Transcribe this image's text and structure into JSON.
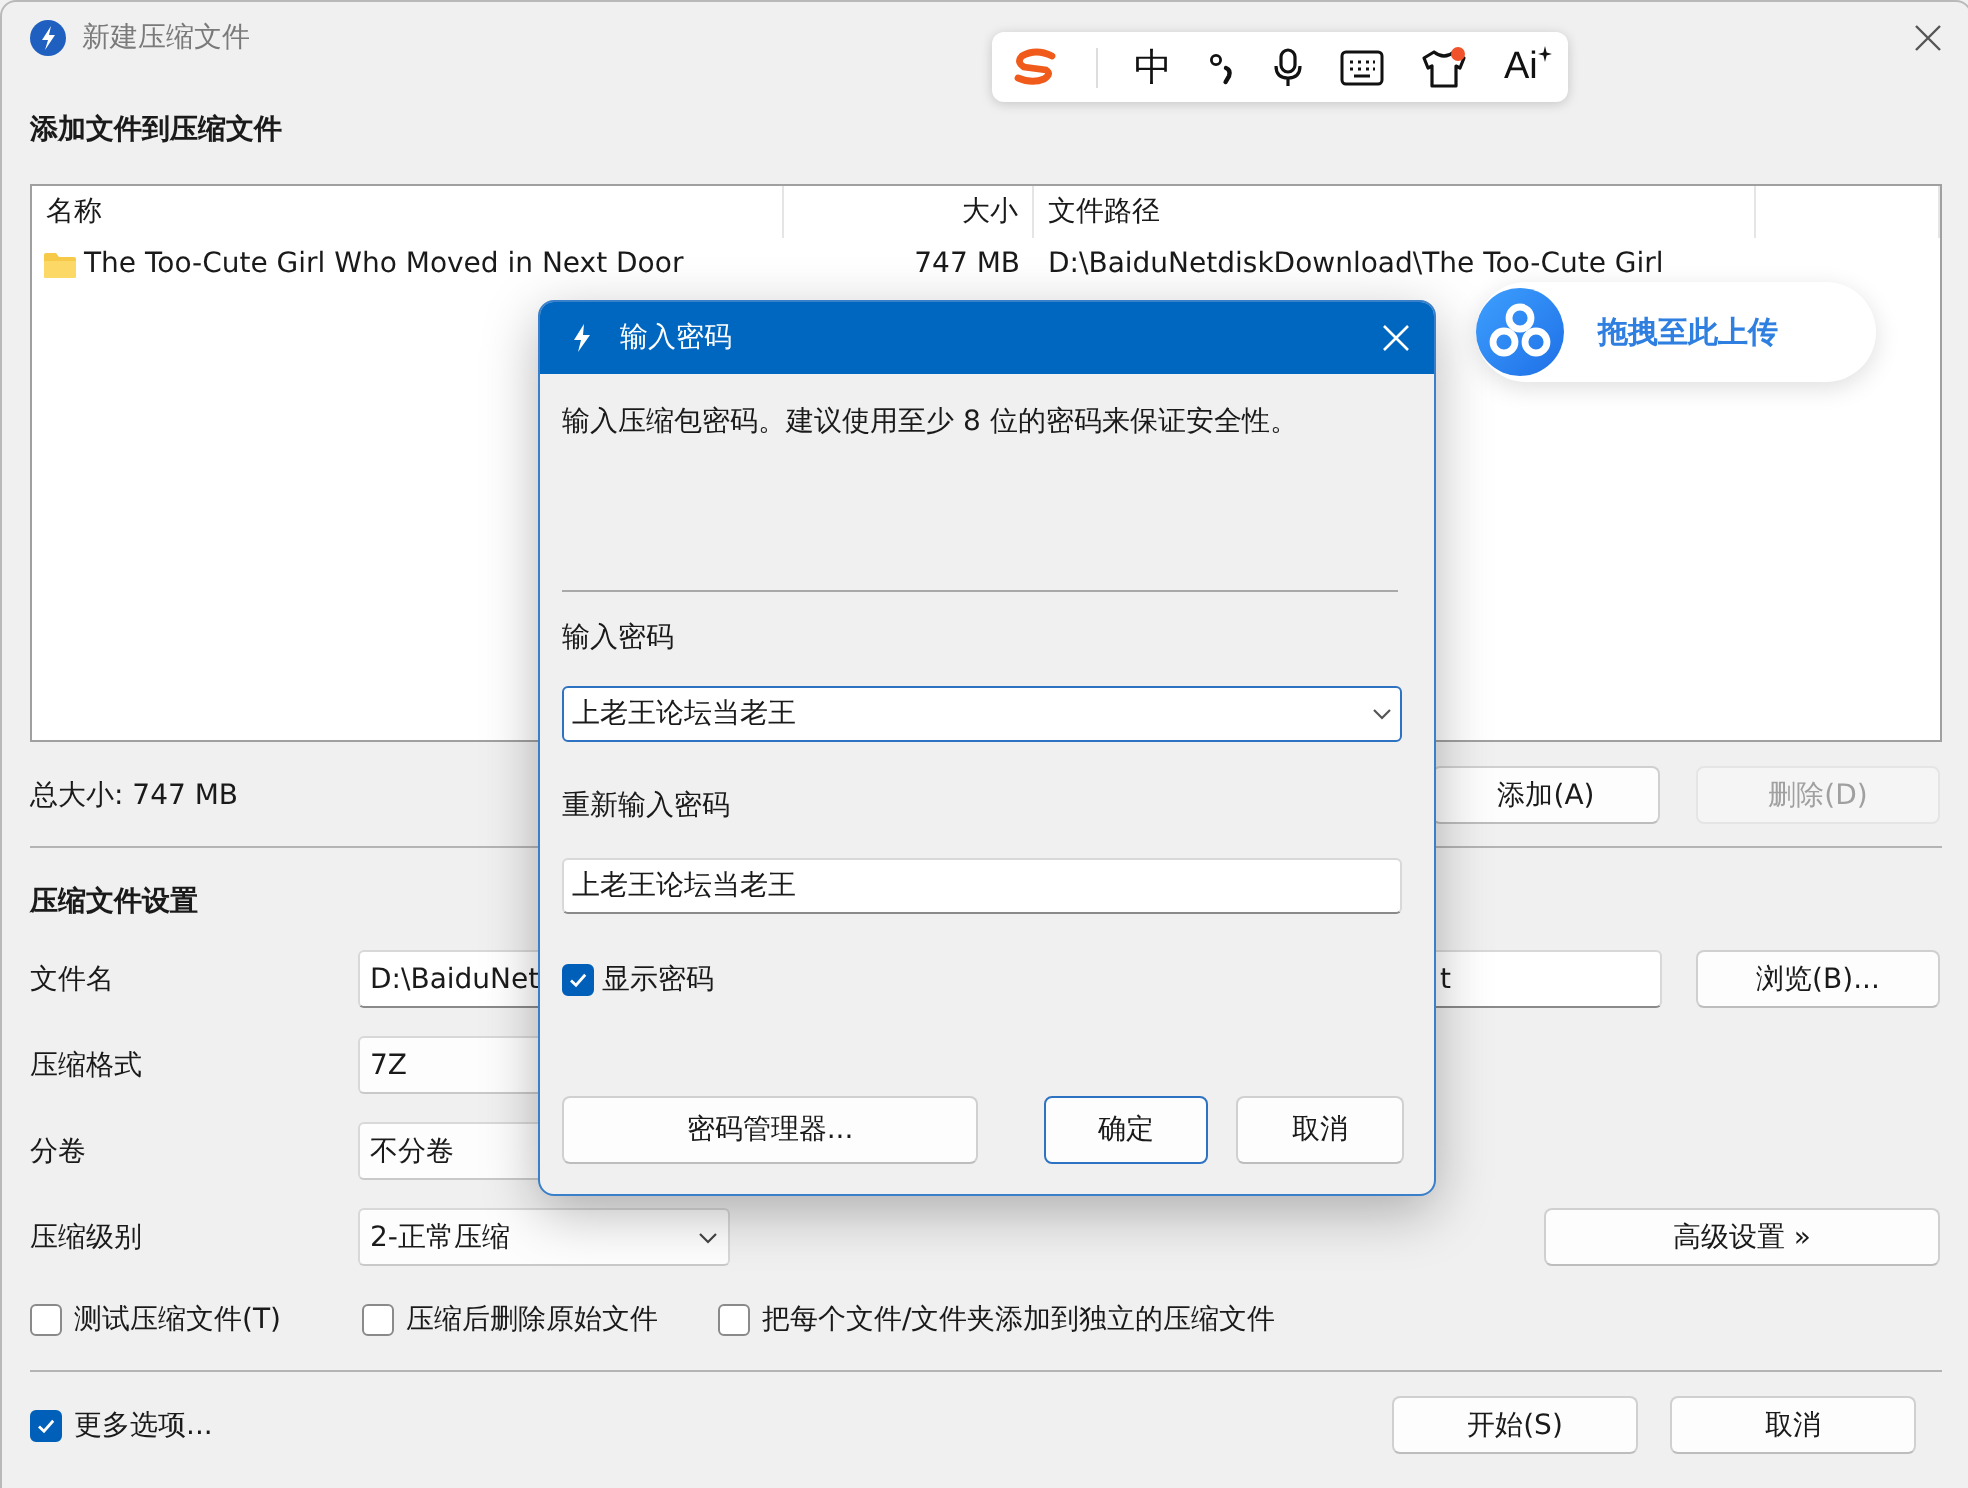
{
  "window": {
    "title": "新建压缩文件"
  },
  "files_section": {
    "heading": "添加文件到压缩文件",
    "columns": [
      "名称",
      "大小",
      "文件路径"
    ],
    "rows": [
      {
        "name": "The Too-Cute Girl Who Moved in Next Door",
        "size": "747 MB",
        "path": "D:\\BaiduNetdiskDownload\\The Too-Cute Girl"
      }
    ],
    "total": "总大小: 747 MB",
    "buttons": [
      {
        "label": "添加(A)",
        "disabled": false
      },
      {
        "label": "删除(D)",
        "disabled": true
      }
    ]
  },
  "settings": {
    "heading": "压缩文件设置",
    "fields": [
      {
        "kind": "text",
        "label": "文件名",
        "value_parts": [
          "D:\\BaiduNet",
          "t"
        ]
      },
      {
        "kind": "select",
        "label": "压缩格式",
        "value": "7Z"
      },
      {
        "kind": "select",
        "label": "分卷",
        "value": "不分卷"
      },
      {
        "kind": "select",
        "label": "压缩级别",
        "value": "2-正常压缩"
      }
    ],
    "browse_button": "浏览(B)...",
    "advanced_button": "高级设置 »",
    "options": [
      {
        "label": "测试压缩文件(T)",
        "checked": false
      },
      {
        "label": "压缩后删除原始文件",
        "checked": false
      },
      {
        "label": "把每个文件/文件夹添加到独立的压缩文件",
        "checked": false
      }
    ]
  },
  "footer": {
    "more_options": {
      "label": "更多选项...",
      "checked": true
    },
    "buttons": [
      "开始(S)",
      "取消"
    ]
  },
  "password_dialog": {
    "title": "输入密码",
    "description": "输入压缩包密码。建议使用至少 8 位的密码来保证安全性。",
    "password_label": "输入密码",
    "password": "上老王论坛当老王",
    "confirm_label": "重新输入密码",
    "confirm": "上老王论坛当老王",
    "show_password": {
      "label": "显示密码",
      "checked": true
    },
    "buttons": [
      {
        "label": "密码管理器...",
        "default": false
      },
      {
        "label": "确定",
        "default": true
      },
      {
        "label": "取消",
        "default": false
      }
    ]
  },
  "ime_toolbar": {
    "language": "中",
    "ai_label": "Ai",
    "notification": true
  },
  "upload_bubble": {
    "label": "拖拽至此上传"
  }
}
